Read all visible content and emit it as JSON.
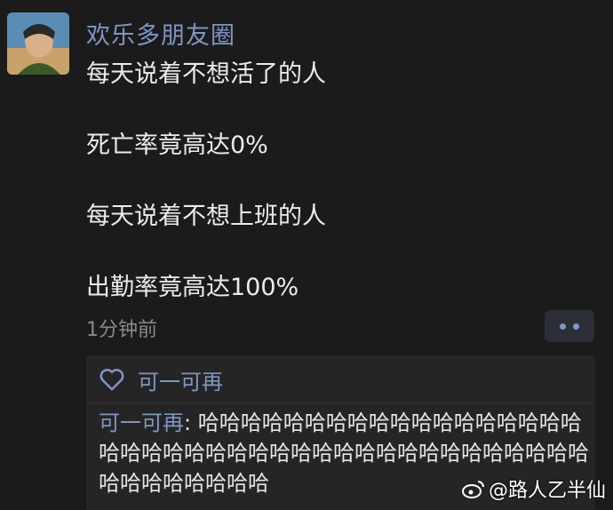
{
  "post": {
    "username": "欢乐多朋友圈",
    "lines": [
      "每天说着不想活了的人",
      "死亡率竟高达0%",
      "每天说着不想上班的人",
      "出勤率竟高达100%"
    ],
    "time": "1分钟前"
  },
  "likes": {
    "names": "可一可再"
  },
  "comment": {
    "author": "可一可再",
    "separator": ": ",
    "text": "哈哈哈哈哈哈哈哈哈哈哈哈哈哈哈哈哈哈哈哈哈哈哈哈哈哈哈哈哈哈哈哈哈哈哈哈哈哈哈哈哈哈哈哈哈哈哈哈哈"
  },
  "watermark": {
    "text": "@路人乙半仙"
  },
  "colors": {
    "background": "#1b1b1b",
    "name_link": "#7f95c4",
    "panel": "#252525"
  }
}
